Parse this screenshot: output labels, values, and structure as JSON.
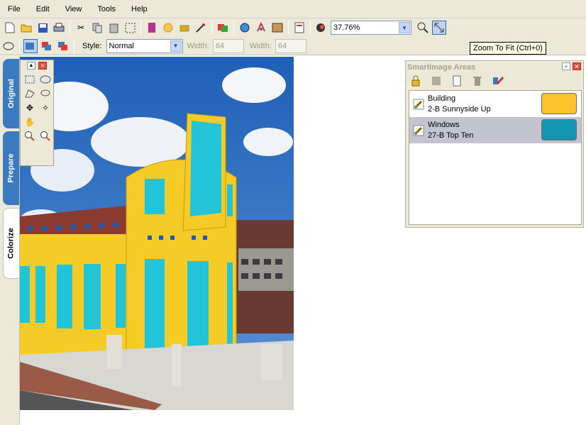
{
  "menu": [
    "File",
    "Edit",
    "View",
    "Tools",
    "Help"
  ],
  "toolbar": {
    "zoom_value": "37.76%",
    "icons": [
      "new-icon",
      "open-icon",
      "save-icon",
      "print-icon",
      "cut-icon",
      "copy-icon",
      "paste-icon",
      "select-icon",
      "paint-icon",
      "color-wheel-icon",
      "fill-icon",
      "eyedropper-icon",
      "layers-icon",
      "globe-icon",
      "palette-icon",
      "image-icon",
      "document-icon",
      "color-match-icon",
      "zoom-100-icon",
      "zoom-fit-icon"
    ]
  },
  "toolbar2": {
    "style_label": "Style:",
    "style_value": "Normal",
    "width_label": "Width:",
    "width_value": "64",
    "height_label": "Width:",
    "height_value": "64"
  },
  "tooltip": "Zoom To Fit (Ctrl+0)",
  "sidetabs": [
    "Original",
    "Prepare",
    "Colorize"
  ],
  "panel": {
    "title": "SmartImage Areas",
    "areas": [
      {
        "name": "Building",
        "color_name": "2-B Sunnyside Up",
        "color": "#fcc32c"
      },
      {
        "name": "Windows",
        "color_name": "27-B Top Ten",
        "color": "#1396b0"
      }
    ]
  },
  "colors": {
    "chrome": "#ece9d8",
    "tab_blue": "#3a7ac0",
    "building_yellow": "#f5cb27",
    "window_cyan": "#22c4d8",
    "sky": "#2e6fc3"
  }
}
